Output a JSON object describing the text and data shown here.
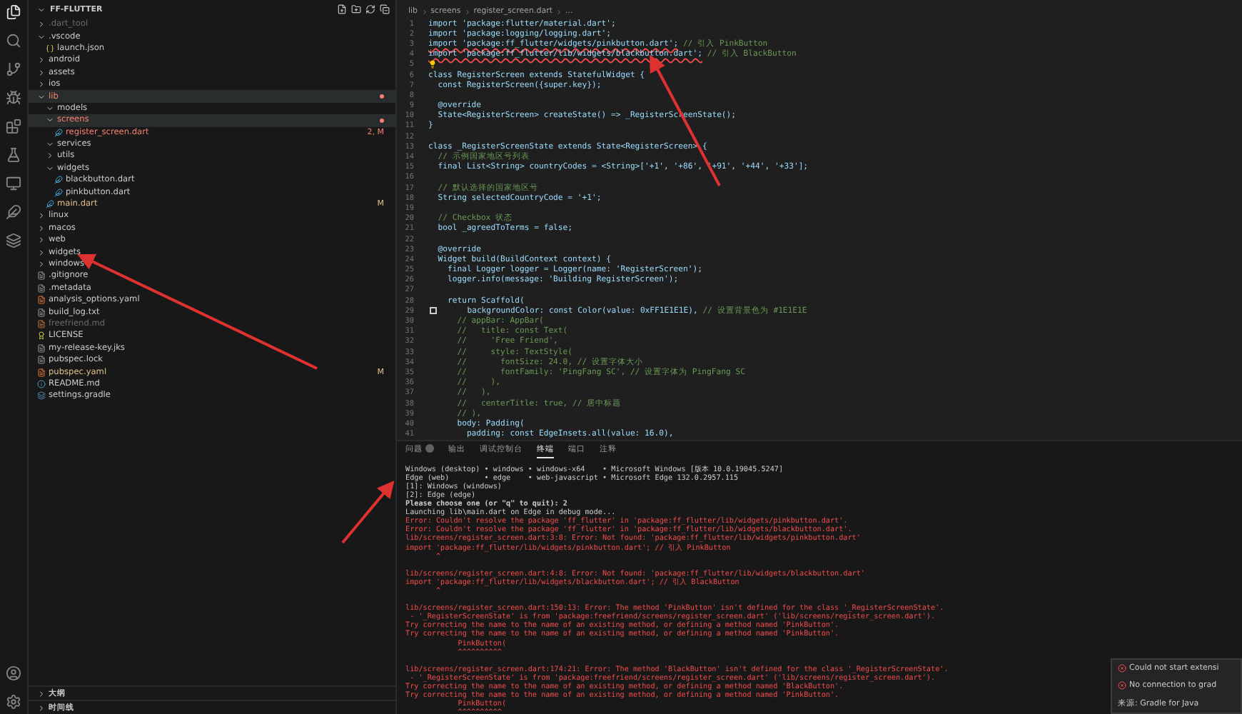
{
  "activity_bar": {
    "items": [
      {
        "kind": "files",
        "selected": true
      },
      {
        "kind": "search",
        "selected": false
      },
      {
        "kind": "source-control",
        "selected": false
      },
      {
        "kind": "debug",
        "selected": false
      },
      {
        "kind": "extensions",
        "selected": false
      },
      {
        "kind": "test",
        "selected": false
      },
      {
        "kind": "remote",
        "selected": false
      },
      {
        "kind": "flutter",
        "selected": false
      },
      {
        "kind": "gradle",
        "selected": false
      }
    ]
  },
  "explorer": {
    "title": "FF-FLUTTER",
    "tree": [
      {
        "label": ".dart_tool",
        "kind": "folder",
        "expanded": false,
        "selected": false,
        "color": "#6b6b6b"
      },
      {
        "label": ".vscode",
        "kind": "folder",
        "expanded": true,
        "selected": false,
        "color": "#cccccc",
        "children": [
          {
            "label": "launch.json",
            "kind": "json",
            "selected": false,
            "color": "#cccccc"
          }
        ]
      },
      {
        "label": "android",
        "kind": "folder",
        "expanded": false,
        "selected": false,
        "color": "#cccccc"
      },
      {
        "label": "assets",
        "kind": "folder",
        "expanded": false,
        "selected": false,
        "color": "#cccccc"
      },
      {
        "label": "ios",
        "kind": "folder",
        "expanded": false,
        "selected": false,
        "color": "#cccccc"
      },
      {
        "label": "lib",
        "kind": "folder",
        "expanded": true,
        "selected": true,
        "color": "#f88070",
        "dot": true,
        "children": [
          {
            "label": "models",
            "kind": "folder",
            "expanded": true,
            "selected": false,
            "color": "#cccccc"
          },
          {
            "label": "screens",
            "kind": "folder",
            "expanded": true,
            "selected": true,
            "color": "#f88070",
            "dot": true,
            "children": [
              {
                "label": "register_screen.dart",
                "kind": "dart",
                "selected": false,
                "color": "#f88070",
                "badge": "2, M"
              }
            ]
          },
          {
            "label": "services",
            "kind": "folder",
            "expanded": true,
            "selected": false,
            "color": "#cccccc"
          },
          {
            "label": "utils",
            "kind": "folder",
            "expanded": false,
            "selected": false,
            "color": "#cccccc"
          },
          {
            "label": "widgets",
            "kind": "folder",
            "expanded": true,
            "selected": false,
            "color": "#cccccc",
            "children": [
              {
                "label": "blackbutton.dart",
                "kind": "dart",
                "selected": false,
                "color": "#cccccc"
              },
              {
                "label": "pinkbutton.dart",
                "kind": "dart",
                "selected": false,
                "color": "#cccccc"
              }
            ]
          },
          {
            "label": "main.dart",
            "kind": "dart",
            "selected": false,
            "color": "#e2c08d",
            "badge": "M"
          }
        ]
      },
      {
        "label": "linux",
        "kind": "folder",
        "expanded": false,
        "selected": false,
        "color": "#cccccc"
      },
      {
        "label": "macos",
        "kind": "folder",
        "expanded": false,
        "selected": false,
        "color": "#cccccc"
      },
      {
        "label": "web",
        "kind": "folder",
        "expanded": false,
        "selected": false,
        "color": "#cccccc"
      },
      {
        "label": "widgets",
        "kind": "folder",
        "expanded": false,
        "selected": false,
        "color": "#cccccc"
      },
      {
        "label": "windows",
        "kind": "folder",
        "expanded": false,
        "selected": false,
        "color": "#cccccc"
      },
      {
        "label": ".gitignore",
        "kind": "text",
        "selected": false,
        "color": "#cccccc"
      },
      {
        "label": ".metadata",
        "kind": "text",
        "selected": false,
        "color": "#cccccc"
      },
      {
        "label": "analysis_options.yaml",
        "kind": "yaml",
        "selected": false,
        "color": "#cccccc"
      },
      {
        "label": "build_log.txt",
        "kind": "text",
        "selected": false,
        "color": "#cccccc"
      },
      {
        "label": "freefriend.md",
        "kind": "markdown",
        "selected": false,
        "color": "#6b6b6b"
      },
      {
        "label": "LICENSE",
        "kind": "license",
        "selected": false,
        "color": "#cccccc"
      },
      {
        "label": "my-release-key.jks",
        "kind": "text",
        "selected": false,
        "color": "#cccccc"
      },
      {
        "label": "pubspec.lock",
        "kind": "text",
        "selected": false,
        "color": "#cccccc"
      },
      {
        "label": "pubspec.yaml",
        "kind": "yaml",
        "selected": false,
        "color": "#e2c08d",
        "badge": "M"
      },
      {
        "label": "README.md",
        "kind": "info",
        "selected": false,
        "color": "#cccccc"
      },
      {
        "label": "settings.gradle",
        "kind": "gradle",
        "selected": false,
        "color": "#cccccc"
      }
    ],
    "sections": [
      {
        "label": "大纲",
        "expanded": false
      },
      {
        "label": "时间线",
        "expanded": false
      }
    ]
  },
  "breadcrumb": [
    "lib",
    "screens",
    "register_screen.dart",
    "..."
  ],
  "code_lines": [
    {
      "n": "1",
      "kind": "code",
      "text": "import 'package:flutter/material.dart';"
    },
    {
      "n": "2",
      "kind": "code",
      "text": "import 'package:logging/logging.dart';"
    },
    {
      "n": "3",
      "kind": "code",
      "text": "import 'package:ff_flutter/widgets/pinkbutton.dart';",
      "comment": " // 引入 PinkButton",
      "error": true
    },
    {
      "n": "4",
      "kind": "code",
      "text": "import 'package:ff_flutter/lib/widgets/blackbutton.dart';",
      "comment": " // 引入 BlackButton",
      "error": true
    },
    {
      "n": "5",
      "kind": "lightbulb"
    },
    {
      "n": "6",
      "kind": "code",
      "text": "class RegisterScreen extends StatefulWidget {"
    },
    {
      "n": "7",
      "kind": "code",
      "text": "  const RegisterScreen({super.key});"
    },
    {
      "n": "8",
      "kind": "blank"
    },
    {
      "n": "9",
      "kind": "code",
      "text": "  @override"
    },
    {
      "n": "10",
      "kind": "code",
      "text": "  State<RegisterScreen> createState() => _RegisterScreenState();"
    },
    {
      "n": "11",
      "kind": "code",
      "text": "}"
    },
    {
      "n": "12",
      "kind": "blank"
    },
    {
      "n": "13",
      "kind": "code",
      "text": "class _RegisterScreenState extends State<RegisterScreen> {"
    },
    {
      "n": "14",
      "kind": "comment",
      "text": "  // 示例国家地区号列表"
    },
    {
      "n": "15",
      "kind": "code",
      "text": "  final List<String> countryCodes = <String>['+1', '+86', '+91', '+44', '+33'];"
    },
    {
      "n": "16",
      "kind": "blank"
    },
    {
      "n": "17",
      "kind": "comment",
      "text": "  // 默认选择的国家地区号"
    },
    {
      "n": "18",
      "kind": "code",
      "text": "  String selectedCountryCode = '+1';"
    },
    {
      "n": "19",
      "kind": "blank"
    },
    {
      "n": "20",
      "kind": "comment",
      "text": "  // Checkbox 状态"
    },
    {
      "n": "21",
      "kind": "code",
      "text": "  bool _agreedToTerms = false;"
    },
    {
      "n": "22",
      "kind": "blank"
    },
    {
      "n": "23",
      "kind": "code",
      "text": "  @override"
    },
    {
      "n": "24",
      "kind": "code",
      "text": "  Widget build(BuildContext context) {"
    },
    {
      "n": "25",
      "kind": "code",
      "text": "    final Logger logger = Logger(name: 'RegisterScreen');"
    },
    {
      "n": "26",
      "kind": "code",
      "text": "    logger.info(message: 'Building RegisterScreen');"
    },
    {
      "n": "27",
      "kind": "blank"
    },
    {
      "n": "28",
      "kind": "code",
      "text": "    return Scaffold("
    },
    {
      "n": "29",
      "kind": "code",
      "text": "      backgroundColor: const Color(value: 0xFF1E1E1E),",
      "comment": " // 设置背景色为 #1E1E1E",
      "swatch": true
    },
    {
      "n": "30",
      "kind": "comment",
      "text": "      // appBar: AppBar("
    },
    {
      "n": "31",
      "kind": "comment",
      "text": "      //   title: const Text("
    },
    {
      "n": "32",
      "kind": "comment",
      "text": "      //     'Free Friend',"
    },
    {
      "n": "33",
      "kind": "comment",
      "text": "      //     style: TextStyle("
    },
    {
      "n": "34",
      "kind": "comment",
      "text": "      //       fontSize: 24.0, // 设置字体大小"
    },
    {
      "n": "35",
      "kind": "comment",
      "text": "      //       fontFamily: 'PingFang SC', // 设置字体为 PingFang SC"
    },
    {
      "n": "36",
      "kind": "comment",
      "text": "      //     ),"
    },
    {
      "n": "37",
      "kind": "comment",
      "text": "      //   ),"
    },
    {
      "n": "38",
      "kind": "comment",
      "text": "      //   centerTitle: true, // 居中标题"
    },
    {
      "n": "39",
      "kind": "comment",
      "text": "      // ),"
    },
    {
      "n": "40",
      "kind": "code",
      "text": "      body: Padding("
    },
    {
      "n": "41",
      "kind": "code",
      "text": "        padding: const EdgeInsets.all(value: 16.0),"
    }
  ],
  "panel_tabs": [
    {
      "label": "问题",
      "selected": false,
      "count_badge": true
    },
    {
      "label": "输出",
      "selected": false
    },
    {
      "label": "调试控制台",
      "selected": false
    },
    {
      "label": "终端",
      "selected": true
    },
    {
      "label": "端口",
      "selected": false
    },
    {
      "label": "注释",
      "selected": false
    }
  ],
  "terminal_lines": [
    {
      "kind": "plain",
      "text": "Windows (desktop) • windows • windows-x64    • Microsoft Windows [版本 10.0.19045.5247]"
    },
    {
      "kind": "plain",
      "text": "Edge (web)        • edge    • web-javascript • Microsoft Edge 132.0.2957.115"
    },
    {
      "kind": "plain",
      "text": "[1]: Windows (windows)"
    },
    {
      "kind": "plain",
      "text": "[2]: Edge (edge)"
    },
    {
      "kind": "bold",
      "text": "Please choose one (or \"q\" to quit): 2"
    },
    {
      "kind": "plain",
      "text": "Launching lib\\main.dart on Edge in debug mode..."
    },
    {
      "kind": "error",
      "text": "Error: Couldn't resolve the package 'ff_flutter' in 'package:ff_flutter/lib/widgets/pinkbutton.dart'."
    },
    {
      "kind": "error",
      "text": "Error: Couldn't resolve the package 'ff_flutter' in 'package:ff_flutter/lib/widgets/blackbutton.dart'."
    },
    {
      "kind": "error",
      "text": "lib/screens/register_screen.dart:3:8: Error: Not found: 'package:ff_flutter/lib/widgets/pinkbutton.dart'"
    },
    {
      "kind": "error",
      "text": "import 'package:ff_flutter/lib/widgets/pinkbutton.dart'; // 引入 PinkButton"
    },
    {
      "kind": "error",
      "text": "       ^"
    },
    {
      "kind": "blank"
    },
    {
      "kind": "error",
      "text": "lib/screens/register_screen.dart:4:8: Error: Not found: 'package:ff_flutter/lib/widgets/blackbutton.dart'"
    },
    {
      "kind": "error",
      "text": "import 'package:ff_flutter/lib/widgets/blackbutton.dart'; // 引入 BlackButton"
    },
    {
      "kind": "error",
      "text": "       ^"
    },
    {
      "kind": "blank"
    },
    {
      "kind": "error",
      "text": "lib/screens/register_screen.dart:150:13: Error: The method 'PinkButton' isn't defined for the class '_RegisterScreenState'."
    },
    {
      "kind": "error",
      "text": " - '_RegisterScreenState' is from 'package:freefriend/screens/register_screen.dart' ('lib/screens/register_screen.dart')."
    },
    {
      "kind": "error",
      "text": "Try correcting the name to the name of an existing method, or defining a method named 'PinkButton'."
    },
    {
      "kind": "error",
      "text": "Try correcting the name to the name of an existing method, or defining a method named 'PinkButton'."
    },
    {
      "kind": "error",
      "text": "            PinkButton("
    },
    {
      "kind": "error",
      "text": "            ^^^^^^^^^^"
    },
    {
      "kind": "blank"
    },
    {
      "kind": "error",
      "text": "lib/screens/register_screen.dart:174:21: Error: The method 'BlackButton' isn't defined for the class '_RegisterScreenState'."
    },
    {
      "kind": "error",
      "text": " - '_RegisterScreenState' is from 'package:freefriend/screens/register_screen.dart' ('lib/screens/register_screen.dart')."
    },
    {
      "kind": "error",
      "text": "Try correcting the name to the name of an existing method, or defining a method named 'BlackButton'."
    },
    {
      "kind": "error",
      "text": "Try correcting the name to the name of an existing method, or defining a method named 'PinkButton'."
    },
    {
      "kind": "error",
      "text": "            PinkButton("
    },
    {
      "kind": "error",
      "text": "            ^^^^^^^^^^"
    }
  ],
  "notifications": {
    "items": [
      {
        "kind": "error",
        "text": "Could not start extensi"
      },
      {
        "kind": "error",
        "text": "No connection to grad"
      }
    ],
    "source": "来源: Gradle for Java"
  }
}
